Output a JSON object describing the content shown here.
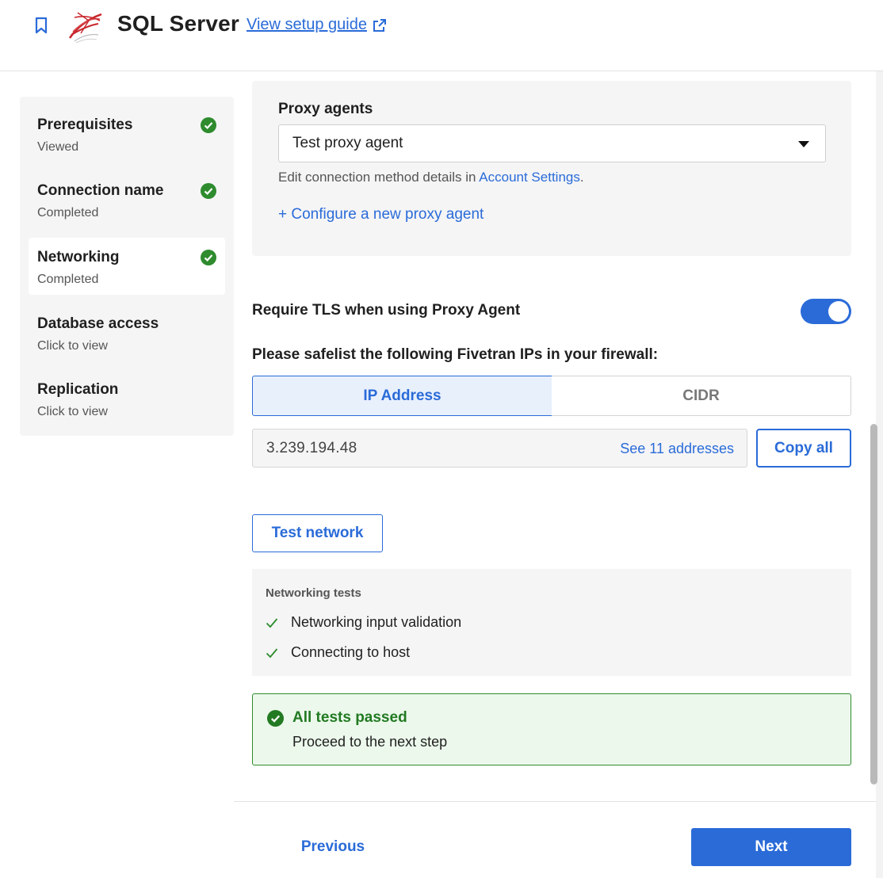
{
  "header": {
    "title": "SQL Server",
    "guide_link": "View setup guide"
  },
  "sidebar": {
    "items": [
      {
        "label": "Prerequisites",
        "status": "Viewed",
        "done": true
      },
      {
        "label": "Connection name",
        "status": "Completed",
        "done": true
      },
      {
        "label": "Networking",
        "status": "Completed",
        "done": true,
        "active": true
      },
      {
        "label": "Database access",
        "status": "Click to view",
        "done": false
      },
      {
        "label": "Replication",
        "status": "Click to view",
        "done": false
      }
    ]
  },
  "proxy": {
    "label": "Proxy agents",
    "selected": "Test proxy agent",
    "helper_prefix": "Edit connection method details in ",
    "helper_link": "Account Settings",
    "helper_suffix": ".",
    "configure": "+ Configure a new proxy agent"
  },
  "tls": {
    "label": "Require TLS when using Proxy Agent",
    "enabled": true
  },
  "safelist": {
    "label": "Please safelist the following Fivetran IPs in your firewall:",
    "tabs": [
      "IP Address",
      "CIDR"
    ],
    "active_tab": "IP Address",
    "ip_value": "3.239.194.48",
    "see_more": "See 11 addresses",
    "copy_label": "Copy all"
  },
  "test_button": "Test network",
  "tests": {
    "title": "Networking tests",
    "items": [
      "Networking input validation",
      "Connecting to host"
    ]
  },
  "result": {
    "title": "All tests passed",
    "subtitle": "Proceed to the next step"
  },
  "footer": {
    "previous": "Previous",
    "next": "Next"
  },
  "colors": {
    "accent": "#2a6bd8",
    "success": "#2e8b2e",
    "success_bg": "#ecf8ec",
    "panel_bg": "#f5f5f6"
  }
}
